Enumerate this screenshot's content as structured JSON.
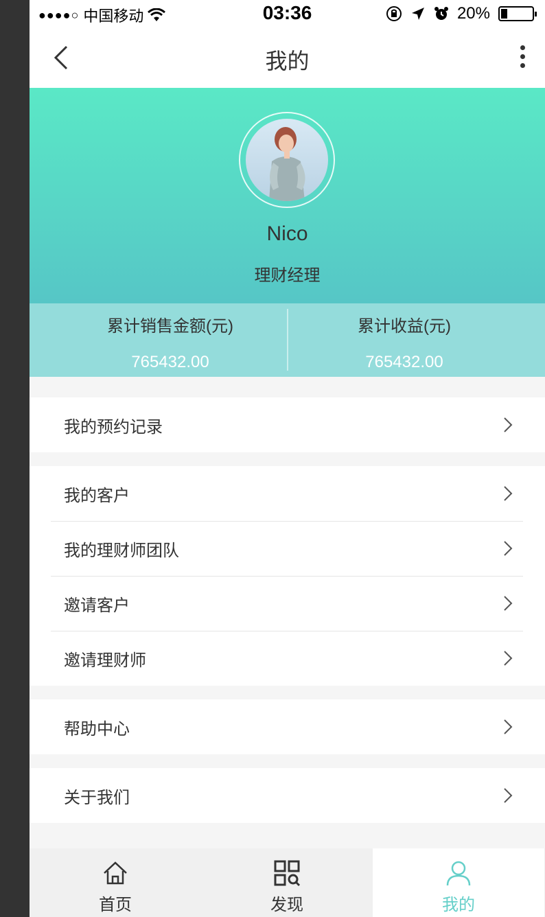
{
  "status_bar": {
    "carrier": "中国移动",
    "time": "03:36",
    "battery": "20%"
  },
  "nav": {
    "title": "我的"
  },
  "profile": {
    "name": "Nico",
    "role": "理财经理"
  },
  "stats": {
    "sales_label": "累计销售金额(元)",
    "sales_value": "765432.00",
    "income_label": "累计收益(元)",
    "income_value": "765432.00"
  },
  "menu": {
    "appointments": "我的预约记录",
    "clients": "我的客户",
    "team": "我的理财师团队",
    "invite_clients": "邀请客户",
    "invite_planners": "邀请理财师",
    "help": "帮助中心",
    "about": "关于我们"
  },
  "tabs": [
    {
      "label": "首页"
    },
    {
      "label": "发现"
    },
    {
      "label": "我的"
    }
  ],
  "colors": {
    "accent": "#65cfc9",
    "text": "#333333",
    "divider": "#e5e5e5",
    "header_top": "#5ae8c6",
    "header_bottom": "#56c6c6"
  }
}
